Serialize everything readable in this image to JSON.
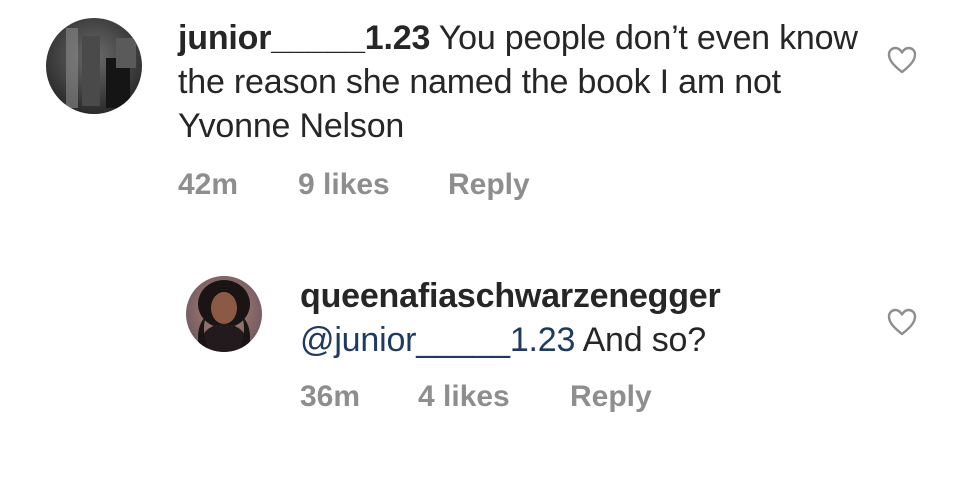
{
  "comments": [
    {
      "username": "junior_____1.23",
      "text": " You people don’t even know the reason she named the book I am not Yvonne Nelson",
      "time": "42m",
      "likes": "9 likes",
      "reply_label": "Reply",
      "avatar_icon": "user-avatar"
    },
    {
      "username": "queenafiaschwarzenegger",
      "mention": "@junior_____1.23",
      "text": " And so?",
      "time": "36m",
      "likes": "4 likes",
      "reply_label": "Reply",
      "avatar_icon": "user-avatar"
    }
  ],
  "icons": {
    "like": "heart-icon"
  },
  "colors": {
    "text": "#262626",
    "meta": "#8e8e8e",
    "mention": "#1f3a61"
  }
}
